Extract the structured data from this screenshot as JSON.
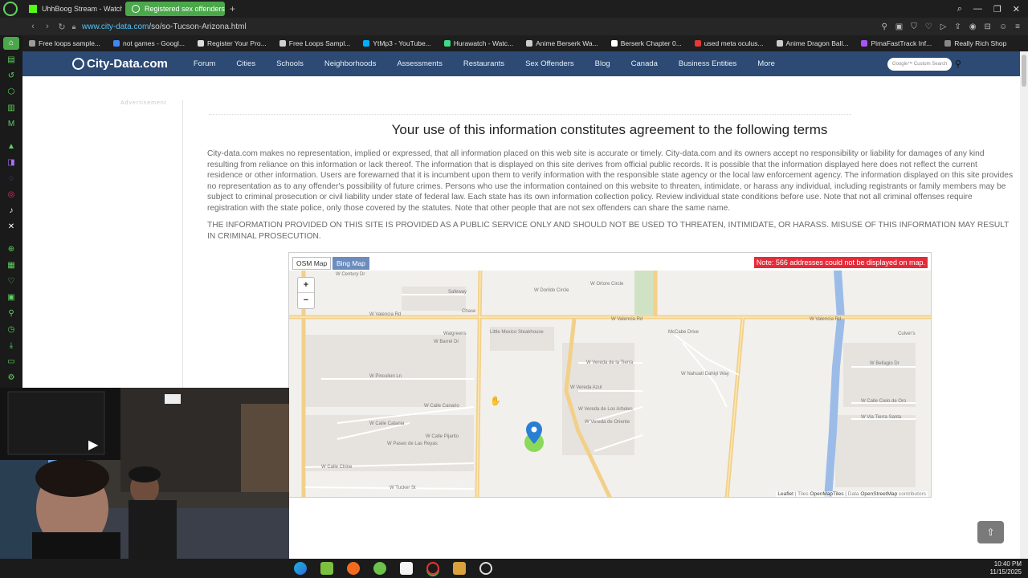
{
  "browser": {
    "tabs": [
      {
        "label": "UhhBoog Stream - Watch",
        "active": false
      },
      {
        "label": "Registered sex offenders",
        "active": true
      }
    ],
    "url_host": "www.city-data.com",
    "url_path": "/so/so-Tucson-Arizona.html",
    "bookmarks": [
      "Free loops sample...",
      "not games - Googl...",
      "Register Your Pro...",
      "Free Loops Sampl...",
      "YtMp3 - YouTube...",
      "Hurawatch - Watc...",
      "Anime Berserk Wa...",
      "Berserk Chapter 0...",
      "used meta oculus...",
      "Anime Dragon Ball...",
      "PimaFastTrack Inf...",
      "Really Rich Shop"
    ]
  },
  "site": {
    "logo": "City-Data.com",
    "nav": [
      "Forum",
      "Cities",
      "Schools",
      "Neighborhoods",
      "Assessments",
      "Restaurants",
      "Sex Offenders",
      "Blog",
      "Canada",
      "Business Entities",
      "More"
    ],
    "search_placeholder": "Google™ Custom Search"
  },
  "main": {
    "ad_label": "Advertisement",
    "terms_title": "Your use of this information constitutes agreement to the following terms",
    "terms_body": "City-data.com makes no representation, implied or expressed, that all information placed on this web site is accurate or timely. City-data.com and its owners accept no responsibility or liability for damages of any kind resulting from reliance on this information or lack thereof. The information that is displayed on this site derives from official public records. It is possible that the information displayed here does not reflect the current residence or other information. Users are forewarned that it is incumbent upon them to verify information with the responsible state agency or the local law enforcement agency. The information displayed on this site provides no representation as to any offender's possibility of future crimes. Persons who use the information contained on this website to threaten, intimidate, or harass any individual, including registrants or family members may be subject to criminal prosecution or civil liability under state of federal law. Each state has its own information collection policy. Review individual state conditions before use. Note that not all criminal offenses require registration with the state police, only those covered by the statutes. Note that other people that are not sex offenders can share the same name.",
    "terms_caps": "THE INFORMATION PROVIDED ON THIS SITE IS PROVIDED AS A PUBLIC SERVICE ONLY AND SHOULD NOT BE USED TO THREATEN, INTIMIDATE, OR HARASS. MISUSE OF THIS INFORMATION MAY RESULT IN CRIMINAL PROSECUTION."
  },
  "map": {
    "tab_osm": "OSM Map",
    "tab_bing": "Bing Map",
    "note": "Note: 566 addresses could not be displayed on map.",
    "zoom_in": "+",
    "zoom_out": "−",
    "attrib_leaflet": "Leaflet",
    "attrib_tiles": "| Tiles",
    "attrib_tiles_src": "OpenMapTiles",
    "attrib_data": "| Data",
    "attrib_data_src": "OpenStreetMap",
    "attrib_contrib": "contributors",
    "streets": [
      "W Century Dr",
      "W Dorildo Circle",
      "W Ortore Circle",
      "Safeway",
      "W Valencia Rd",
      "W Valencia Rd",
      "W Valencia Rd",
      "Chase",
      "Walgreens",
      "W Barrel Dr",
      "Little Mexico Steakhouse",
      "McCabe Drive",
      "Culver's",
      "W Pinculion Ln",
      "W Vereda de la Tierra",
      "W Nahuatl Dahiyi Way",
      "W Bellagio Dr",
      "W Calle Canario",
      "W Vereda Azul",
      "W Calle Pijarito",
      "W Calle Chine",
      "W Tucker St",
      "W Calle Catania",
      "W Vereda de Los Arboles",
      "W Paseo de Las Reyas",
      "W Vereda de Oriente",
      "W Calle Cielo de Oro",
      "W Via Tierra Santa"
    ],
    "accent": "#e52b3a"
  },
  "taskbar": {
    "time": "10:40 PM",
    "date": "11/15/2025"
  },
  "colors": {
    "site_nav": "#2c4a74",
    "browser_accent": "#4aa84a",
    "note_red": "#e52b3a"
  }
}
